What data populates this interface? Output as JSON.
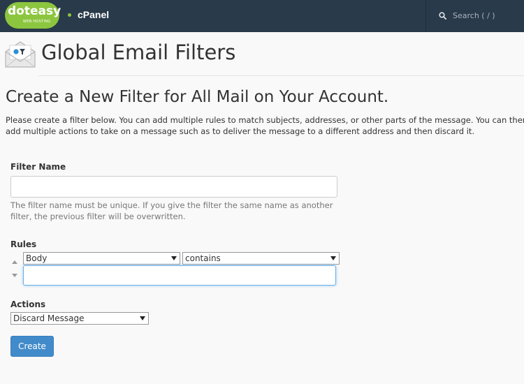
{
  "header": {
    "logo_word": "doteasy",
    "logo_sub": "WEB HOSTING",
    "brand": "cPanel",
    "search_placeholder": "Search ( / )"
  },
  "page": {
    "title": "Global Email Filters",
    "section_title": "Create a New Filter for All Mail on Your Account.",
    "intro": "Please create a filter below. You can add multiple rules to match subjects, addresses, or other parts of the message. You can then add multiple actions to take on a message such as to deliver the message to a different address and then discard it."
  },
  "form": {
    "filter_name_label": "Filter Name",
    "filter_name_value": "",
    "filter_name_help": "The filter name must be unique. If you give the filter the same name as another filter, the previous filter will be overwritten.",
    "rules_label": "Rules",
    "rule_part": "Body",
    "rule_operator": "contains",
    "rule_value": "",
    "actions_label": "Actions",
    "action": "Discard Message",
    "create_label": "Create"
  },
  "colors": {
    "topbar": "#293a4a",
    "brand_green": "#8cc63f",
    "primary_button": "#428bca",
    "focus_border": "#66afe9"
  }
}
